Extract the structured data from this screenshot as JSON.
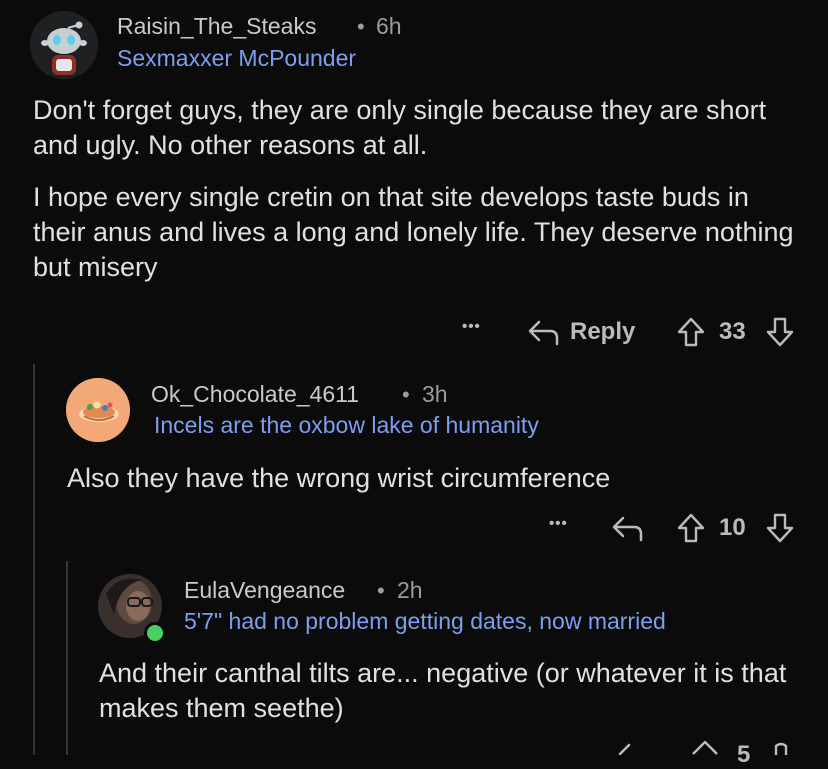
{
  "comments": [
    {
      "username": "Raisin_The_Steaks",
      "separator": "•",
      "time": "6h",
      "flair": "Sexmaxxer McPounder",
      "paragraphs": [
        "Don't forget guys, they are only single because they are short and ugly. No other reasons at all.",
        "I hope every single cretin on that site develops taste buds in their anus and lives a long and lonely life. They deserve nothing but misery"
      ],
      "more_label": "•••",
      "reply_label": "Reply",
      "score": "33"
    },
    {
      "username": "Ok_Chocolate_4611",
      "separator": "•",
      "time": "3h",
      "flair": "Incels are the oxbow lake of humanity",
      "paragraphs": [
        "Also they have the wrong wrist circumference"
      ],
      "more_label": "•••",
      "score": "10"
    },
    {
      "username": "EulaVengeance",
      "separator": "•",
      "time": "2h",
      "flair": "5'7\" had no problem getting dates, now married",
      "online": true,
      "paragraphs": [
        "And their canthal tilts are... negative (or whatever it is that makes them seethe)"
      ],
      "score": "5"
    }
  ],
  "colors": {
    "background": "#0b0b0b",
    "flair": "#7d9ff0",
    "online": "#46d160",
    "thread_line": "#343536"
  }
}
